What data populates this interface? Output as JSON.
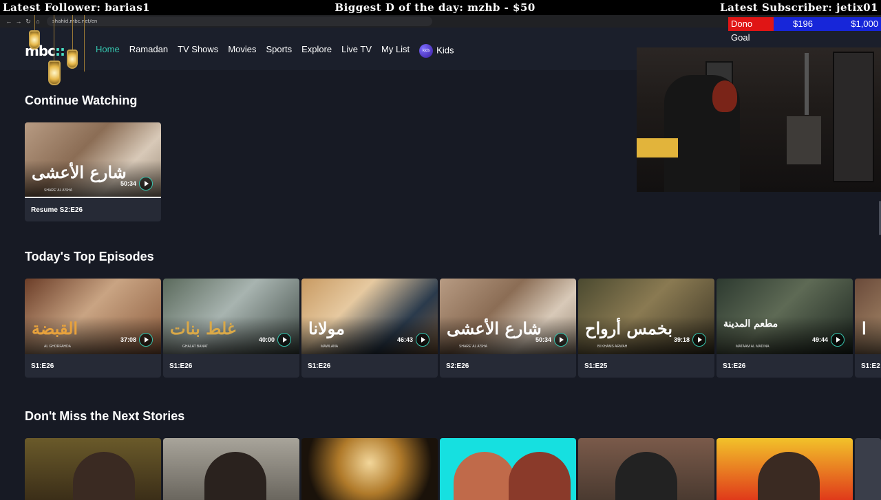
{
  "stream": {
    "latest_follower": "Latest Follower: barias1",
    "biggest_d": "Biggest D of the day: mzhb - $50",
    "latest_subscriber": "Latest Subscriber: jetix01",
    "dono_goal_label": "Dono Goal",
    "dono_current": "$196",
    "dono_target": "$1,000"
  },
  "browser": {
    "url": "shahid.mbc.net/en",
    "back_icon": "arrow-left",
    "forward_icon": "arrow-right",
    "reload_icon": "reload",
    "home_icon": "home"
  },
  "header": {
    "logo": "mbc",
    "nav": [
      {
        "label": "Home",
        "active": true
      },
      {
        "label": "Ramadan"
      },
      {
        "label": "TV Shows"
      },
      {
        "label": "Movies"
      },
      {
        "label": "Sports"
      },
      {
        "label": "Explore"
      },
      {
        "label": "Live TV"
      },
      {
        "label": "My List"
      },
      {
        "label": "Kids"
      }
    ],
    "kids_badge": "kids"
  },
  "continue_watching": {
    "title": "Continue Watching",
    "items": [
      {
        "arabic": "شارع الأعشى",
        "latin": "SHARE' AL A'SHA",
        "duration": "50:34",
        "episode": "Resume S2:E26"
      }
    ]
  },
  "top_episodes": {
    "title": "Today's Top Episodes",
    "items": [
      {
        "arabic": "القبضة",
        "latin": "AL GHORFAHDA",
        "duration": "37:08",
        "episode": "S1:E26"
      },
      {
        "arabic": "غلط بنات",
        "latin": "GHALAT BANAT",
        "duration": "40:00",
        "episode": "S1:E26"
      },
      {
        "arabic": "مولانا",
        "latin": "MAWLANA",
        "duration": "46:43",
        "episode": "S1:E26"
      },
      {
        "arabic": "شارع الأعشى",
        "latin": "SHARE' AL A'SHA",
        "duration": "50:34",
        "episode": "S2:E26"
      },
      {
        "arabic": "بخمس أرواح",
        "latin": "BI KHAMS ARWAH",
        "duration": "39:18",
        "episode": "S1:E25"
      },
      {
        "arabic": "مطعم المدينة",
        "latin": "MATAAM AL MADINA",
        "duration": "49:44",
        "episode": "S1:E26"
      },
      {
        "arabic": "ا",
        "latin": "",
        "duration": "",
        "episode": "S1:E2"
      }
    ]
  },
  "next_stories": {
    "title": "Don't Miss the Next Stories"
  },
  "colors": {
    "accent": "#36c7b0",
    "background": "#171a24",
    "card": "#262a36"
  }
}
